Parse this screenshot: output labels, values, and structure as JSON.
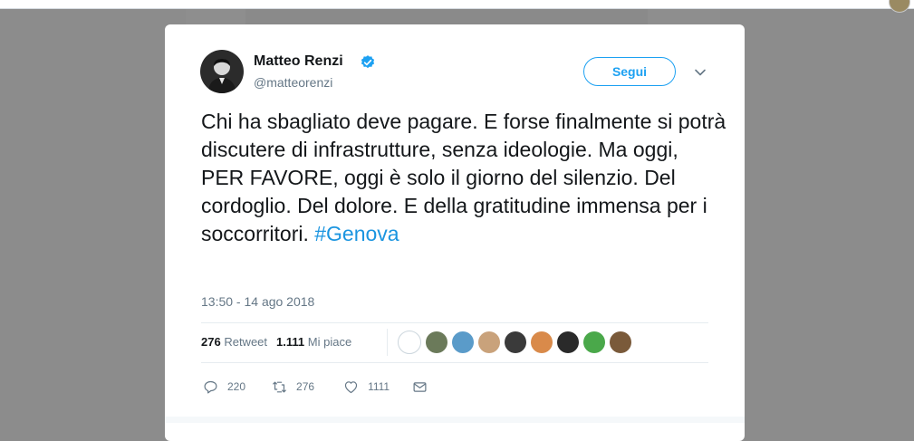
{
  "colors": {
    "accent": "#1da1f2",
    "hashtag": "#1b95e0",
    "text": "#14171a",
    "muted": "#657786",
    "backdrop": "#8c8c8c"
  },
  "author": {
    "name": "Matteo Renzi",
    "handle": "@matteorenzi",
    "verified_icon": "verified-badge-icon",
    "avatar_icon": "profile-photo"
  },
  "header": {
    "follow_label": "Segui",
    "menu_icon": "chevron-down-icon"
  },
  "tweet": {
    "text": "Chi ha sbagliato deve pagare. E forse finalmente si potrà discutere di infrastrutture, senza ideologie. Ma oggi, PER FAVORE, oggi è solo il giorno del silenzio. Del cordoglio. Del dolore. E della gratitudine immensa per i soccorritori. ",
    "hashtag": "#Genova",
    "timestamp": "13:50 - 14 ago 2018"
  },
  "stats": {
    "retweets_count": "276",
    "retweets_label": "Retweet",
    "likes_count": "1.111",
    "likes_label": "Mi piace",
    "likers": [
      {
        "icon": "liker-avatar-1",
        "color": "#ffffff"
      },
      {
        "icon": "liker-avatar-2",
        "color": "#6b7a5a"
      },
      {
        "icon": "liker-avatar-3",
        "color": "#5a9bc9"
      },
      {
        "icon": "liker-avatar-4",
        "color": "#c9a27b"
      },
      {
        "icon": "liker-avatar-5",
        "color": "#3a3a3a"
      },
      {
        "icon": "liker-avatar-6",
        "color": "#d98a4a"
      },
      {
        "icon": "liker-avatar-7",
        "color": "#2a2a2a"
      },
      {
        "icon": "liker-avatar-8",
        "color": "#4aa84a"
      },
      {
        "icon": "liker-avatar-9",
        "color": "#7a5a3a"
      }
    ]
  },
  "actions": {
    "reply": {
      "icon": "reply-icon",
      "count": "220"
    },
    "retweet": {
      "icon": "retweet-icon",
      "count": "276"
    },
    "like": {
      "icon": "heart-icon",
      "count": "1111"
    },
    "message": {
      "icon": "envelope-icon"
    }
  }
}
